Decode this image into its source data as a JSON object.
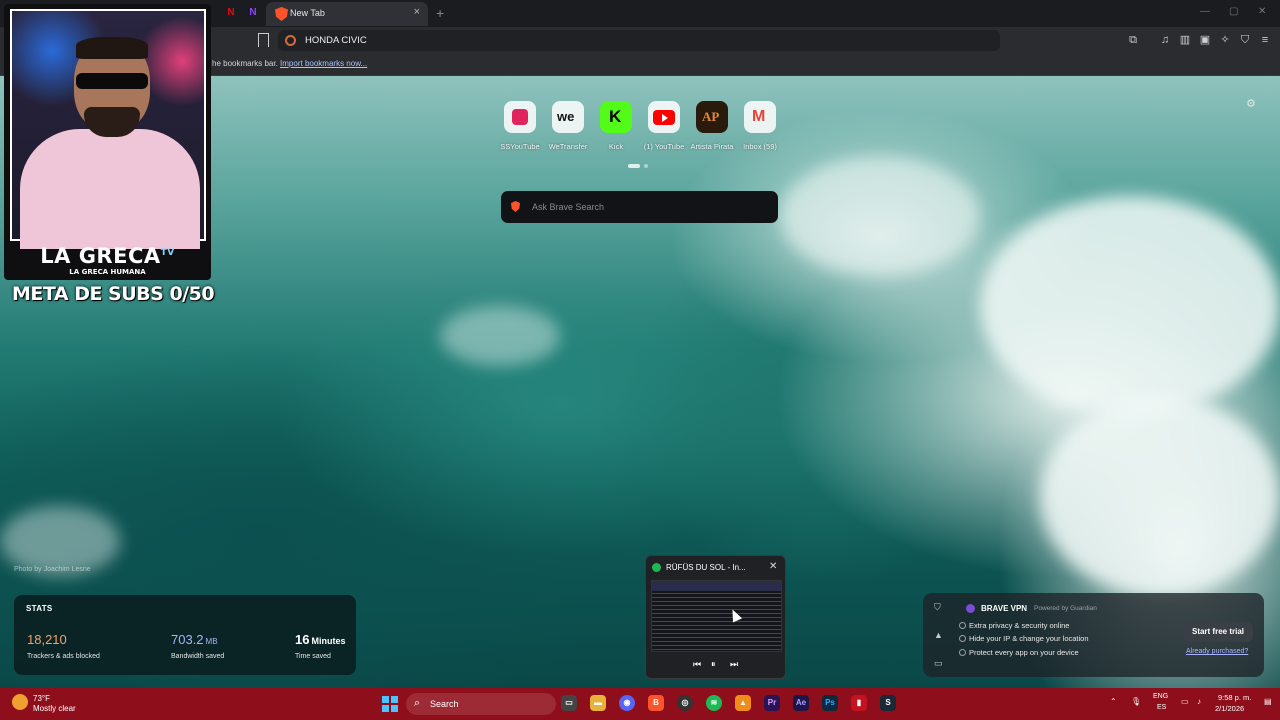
{
  "browser": {
    "tab": {
      "title": "New Tab",
      "close": "×"
    },
    "new_tab": "+",
    "omnibox_text": "HONDA CIVIC",
    "bookmarks_bar": {
      "message": "he bookmarks bar.",
      "import_link": "Import bookmarks now..."
    }
  },
  "new_tab_page": {
    "top_sites": [
      {
        "label": "SSYouTube",
        "icon": "ssyoutube-icon",
        "color": "#e0245e"
      },
      {
        "label": "WeTransfer",
        "icon": "wetransfer-icon",
        "color": "#1a1a1a"
      },
      {
        "label": "Kick",
        "icon": "kick-icon",
        "color": "#53fc18"
      },
      {
        "label": "(1) YouTube",
        "icon": "youtube-icon",
        "color": "#ff0000"
      },
      {
        "label": "Artista Pirata",
        "icon": "artista-pirata-icon",
        "color": "#6b3a12"
      },
      {
        "label": "Inbox (59)",
        "icon": "gmail-icon",
        "color": "#ea4335"
      }
    ],
    "search_placeholder": "Ask Brave Search",
    "photo_credit": "Photo by Joachim Lesne",
    "stats": {
      "heading": "STATS",
      "trackers": {
        "value": "18,210",
        "caption": "Trackers & ads blocked",
        "color": "#f0a36b"
      },
      "bandwidth": {
        "value": "703.2",
        "unit": "MB",
        "caption": "Bandwidth saved",
        "color": "#a6b4ff"
      },
      "time": {
        "value": "16",
        "unit": "Minutes",
        "caption": "Time saved",
        "color": "#ffffff"
      }
    },
    "vpn": {
      "brand": "BRAVE VPN",
      "powered_by": "Powered by Guardian",
      "features": [
        "Extra privacy & security online",
        "Hide your IP & change your location",
        "Protect every app on your device"
      ],
      "cta": "Start free trial",
      "already": "Already purchased?"
    }
  },
  "media_popup": {
    "title": "RÜFÜS DU SOL - In...",
    "close": "✕",
    "controls": [
      "⏮",
      "⏸",
      "⏭"
    ]
  },
  "stream_overlay": {
    "channel": "LA GRECA",
    "tv": "TV",
    "tagline": "LA GRECA HUMANA",
    "goal": "META DE SUBS 0/50"
  },
  "taskbar": {
    "weather_temp": "73°F",
    "weather_desc": "Mostly clear",
    "search": "Search",
    "lang_top": "ENG",
    "lang_bottom": "ES",
    "time": "9:58 p. m.",
    "date": "2/1/2026",
    "accent": "#8f0e1b"
  }
}
